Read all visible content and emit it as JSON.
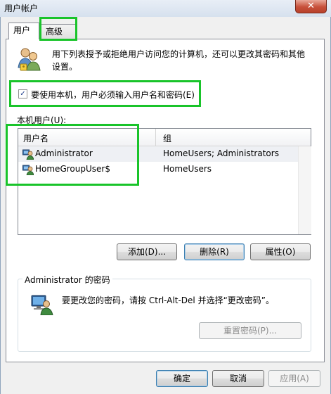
{
  "window": {
    "title": "用户帐户",
    "close_glyph": "✕"
  },
  "tabs": [
    {
      "label": "用户",
      "active": true
    },
    {
      "label": "高级",
      "active": false
    }
  ],
  "intro_text": "用下列表授予或拒绝用户访问您的计算机，还可以更改其密码和其他设置。",
  "require_login_checkbox": {
    "label": "要使用本机，用户必须输入用户名和密码(E)",
    "checked": true
  },
  "local_users": {
    "label": "本机用户(U):",
    "columns": [
      "用户名",
      "组"
    ],
    "rows": [
      {
        "name": "Administrator",
        "group": "HomeUsers; Administrators",
        "selected": true
      },
      {
        "name": "HomeGroupUser$",
        "group": "HomeUsers",
        "selected": false
      }
    ]
  },
  "user_buttons": {
    "add": "添加(D)...",
    "remove": "删除(R)",
    "properties": "属性(O)"
  },
  "password_group": {
    "title": "Administrator 的密码",
    "text": "要更改您的密码，请按 Ctrl-Alt-Del 并选择“更改密码”。",
    "reset_button": "重置密码(P)..."
  },
  "dialog_buttons": {
    "ok": "确定",
    "cancel": "取消",
    "apply": "应用(A)"
  },
  "highlight_color": "#19c42a"
}
